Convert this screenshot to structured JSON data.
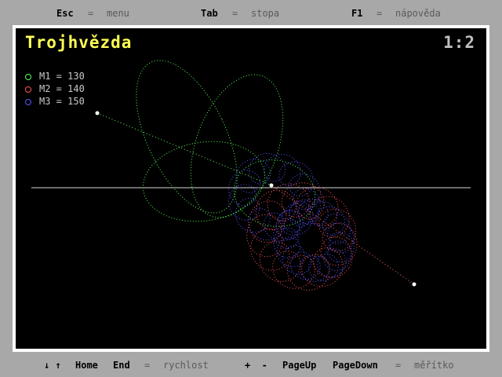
{
  "top_bar": {
    "esc_key": "Esc",
    "esc_eq": "=",
    "esc_action": "menu",
    "tab_key": "Tab",
    "tab_eq": "=",
    "tab_action": "stopa",
    "f1_key": "F1",
    "f1_eq": "=",
    "f1_action": "nápověda"
  },
  "bottom_bar": {
    "arrows": "↓ ↑",
    "home": "Home",
    "end": "End",
    "speed_eq": "=",
    "speed_action": "rychlost",
    "plusminus": "+  -",
    "pageup": "PageUp",
    "pagedown": "PageDown",
    "scale_eq": "=",
    "scale_action": "měřítko"
  },
  "screen": {
    "title": "Trojhvězda",
    "scale": "1:2"
  },
  "legend": [
    {
      "label": "M1 = 130",
      "color": "#55ff55"
    },
    {
      "label": "M2 = 140",
      "color": "#ff5555"
    },
    {
      "label": "M3 = 150",
      "color": "#5555ff"
    }
  ]
}
